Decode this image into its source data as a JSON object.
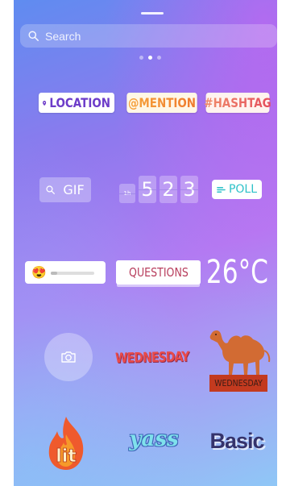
{
  "search": {
    "placeholder": "Search"
  },
  "pager": {
    "total": 3,
    "active": 2
  },
  "stickers": {
    "location": "LOCATION",
    "mention": "@MENTION",
    "hashtag": "#HASHTAG",
    "gif": "GIF",
    "countdown": {
      "prefix": "1h",
      "digits": [
        "5",
        "2",
        "3"
      ]
    },
    "poll": "POLL",
    "emoji_slider": {
      "emoji": "😍"
    },
    "questions": "QUESTIONS",
    "temperature": "26°C",
    "wednesday_text": "WEDNESDAY",
    "camel_label": "WEDNESDAY",
    "lit": "lit",
    "yass": "yass",
    "basic": "Basic"
  },
  "colors": {
    "location": "#6d3cc9",
    "poll": "#2ec2c9",
    "questions": "#b83e5d",
    "camel": "#d26b33",
    "lit_flame": "#ef5a2d"
  }
}
